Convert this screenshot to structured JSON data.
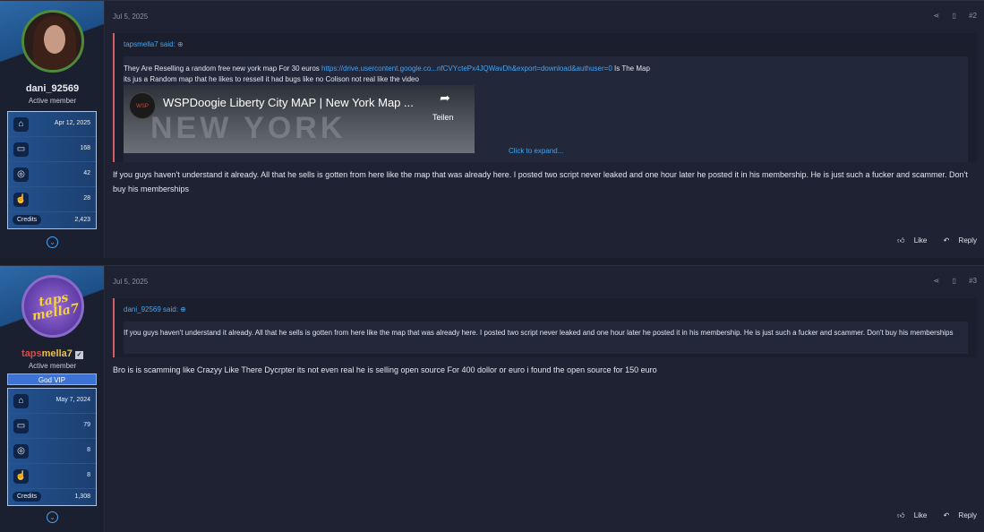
{
  "posts": [
    {
      "author": "dani_92569",
      "role": "Active member",
      "joined": "Apr 12, 2025",
      "messages": "168",
      "reactions": "42",
      "points": "28",
      "credits_label": "Credits",
      "credits": "2,423",
      "date": "Jul 5, 2025",
      "number": "#2",
      "quote_author": "tapsmella7 said:",
      "quote_line1": "They Are Reselling a random free new york map For 30 euros",
      "quote_link": "https://drive.usercontent.google.co...nfCVYctePx4JQWavDh&export=download&authuser=0",
      "quote_line1_end": "Is The Map",
      "quote_line2": "its jus a Random map that he likes to ressell it had bugs like no Colison not real like the video",
      "video_title": "WSPDoogie Liberty City MAP | New York Map ...",
      "video_share": "Teilen",
      "click_expand": "Click to expand...",
      "message": "If you guys haven't understand it already. All that he sells is gotten from here like the map that was already here. I posted two script never leaked and one hour later he posted it in his membership. He is just such a fucker and scammer. Don't buy his memberships",
      "like": "Like",
      "reply": "Reply"
    },
    {
      "author_part1": "taps",
      "author_part2": "mella7",
      "role": "Active member",
      "badge": "God VIP",
      "joined": "May 7, 2024",
      "messages": "79",
      "reactions": "8",
      "points": "8",
      "credits_label": "Credits",
      "credits": "1,308",
      "date": "Jul 5, 2025",
      "number": "#3",
      "quote_author": "dani_92569 said:",
      "quote_text": "If you guys haven't understand it already. All that he sells is gotten from here like the map that was already here. I posted two script never leaked and one hour later he posted it in his membership. He is just such a fucker and scammer. Don't buy his memberships",
      "message": "Bro is is scamming like Crazyy Like There Dycrpter its not even real he is selling open source For 400 dollor or euro i found the open source for 150 euro",
      "like": "Like",
      "reply": "Reply"
    }
  ],
  "colors": {
    "accent": "#46a3ef",
    "quote_bar": "#d55b64",
    "vip_badge": "#3c73d4"
  },
  "icons": [
    "home-icon",
    "message-icon",
    "reaction-icon",
    "trophy-icon",
    "expand-icon",
    "share-icon",
    "bookmark-icon",
    "like-icon",
    "reply-icon"
  ]
}
